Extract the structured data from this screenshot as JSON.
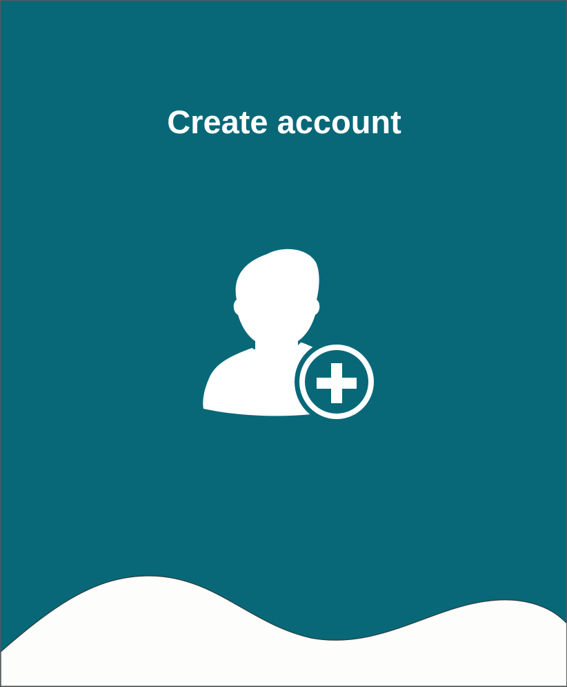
{
  "header": {
    "title": "Create account"
  },
  "main": {
    "icon": "add-user-icon"
  },
  "colors": {
    "background": "#086878",
    "foreground": "#ffffff",
    "wave": "#ffffff"
  }
}
